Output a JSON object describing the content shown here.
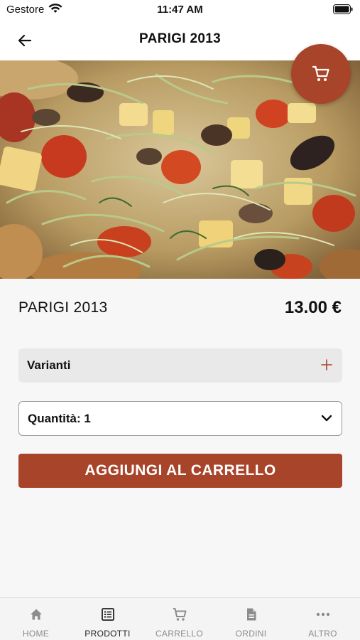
{
  "status_bar": {
    "carrier": "Gestore",
    "time": "11:47 AM",
    "icons": [
      "wifi-icon",
      "battery-icon"
    ]
  },
  "nav": {
    "title": "PARIGI 2013",
    "back_icon": "arrow-left-icon"
  },
  "product": {
    "image": "pizza-photo",
    "name": "PARIGI 2013",
    "price": "13.00 €"
  },
  "cart_fab": {
    "icon": "cart-icon"
  },
  "variants": {
    "label": "Varianti",
    "icon": "plus-icon"
  },
  "quantity": {
    "label": "Quantità: 1",
    "icon": "chevron-down-icon"
  },
  "add_button": {
    "label": "AGGIUNGI AL CARRELLO"
  },
  "tabs": [
    {
      "label": "HOME",
      "icon": "home-icon",
      "active": false
    },
    {
      "label": "PRODOTTI",
      "icon": "list-icon",
      "active": true
    },
    {
      "label": "CARRELLO",
      "icon": "cart-icon",
      "active": false
    },
    {
      "label": "ORDINI",
      "icon": "document-icon",
      "active": false
    },
    {
      "label": "ALTRO",
      "icon": "more-icon",
      "active": false
    }
  ],
  "colors": {
    "accent": "#a8442a",
    "background": "#f7f7f7",
    "variants_bg": "#e9e9e9"
  }
}
